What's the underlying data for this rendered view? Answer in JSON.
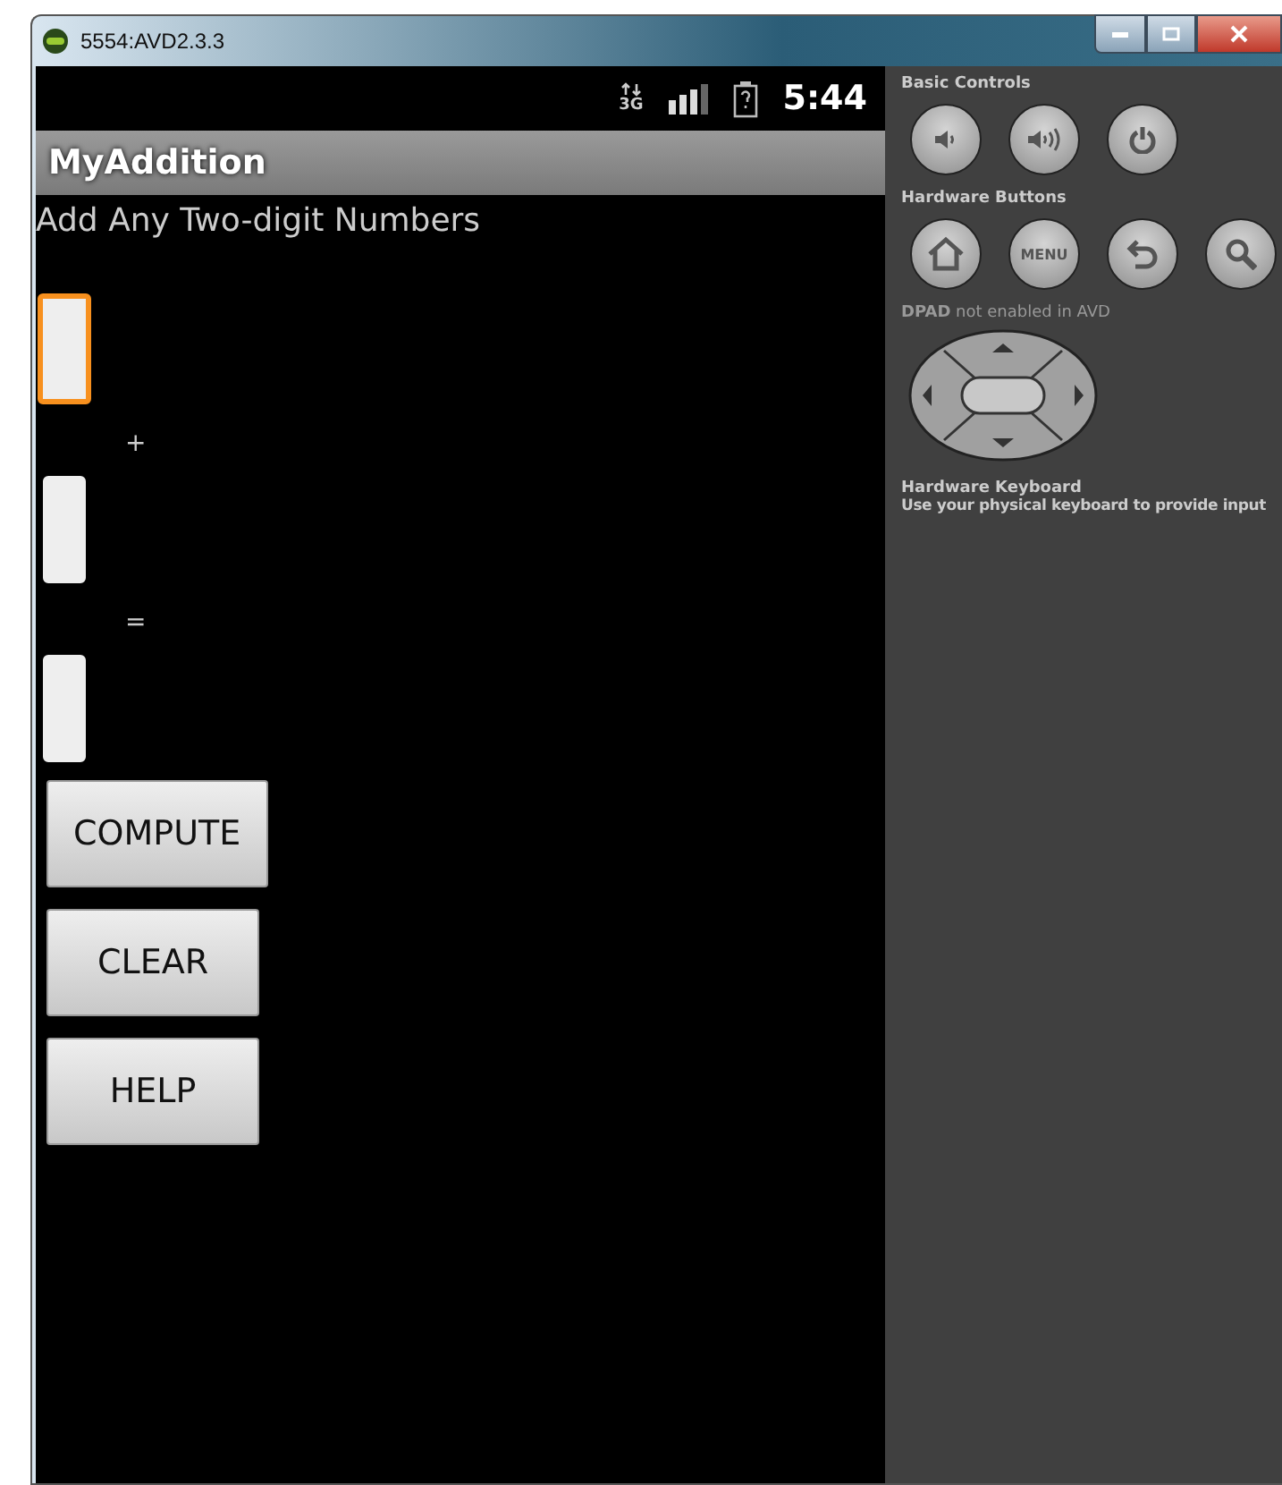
{
  "window": {
    "title": "5554:AVD2.3.3"
  },
  "status_bar": {
    "network": "3G",
    "time": "5:44"
  },
  "app": {
    "title": "MyAddition",
    "heading": "Add Any Two-digit Numbers",
    "rows": [
      {
        "kind": "field",
        "focused": true
      },
      {
        "kind": "operator",
        "text": "+"
      },
      {
        "kind": "field",
        "focused": false
      },
      {
        "kind": "operator",
        "text": "="
      },
      {
        "kind": "field",
        "focused": false
      }
    ],
    "buttons": [
      {
        "label": "COMPUTE"
      },
      {
        "label": "CLEAR"
      },
      {
        "label": "HELP"
      }
    ]
  },
  "controls": {
    "basic": {
      "label": "Basic Controls",
      "keys": [
        {
          "kind": "volume-down"
        },
        {
          "kind": "volume-up"
        },
        {
          "kind": "power"
        }
      ]
    },
    "hardware": {
      "label": "Hardware Buttons",
      "keys": [
        {
          "kind": "home"
        },
        {
          "kind": "menu",
          "text": "MENU"
        },
        {
          "kind": "back"
        },
        {
          "kind": "search"
        }
      ]
    },
    "dpad": {
      "label": "**DPAD** not enabled in AVD"
    },
    "keyboard": {
      "label": "Hardware Keyboard",
      "hint": "Use your physical keyboard to provide input"
    }
  }
}
